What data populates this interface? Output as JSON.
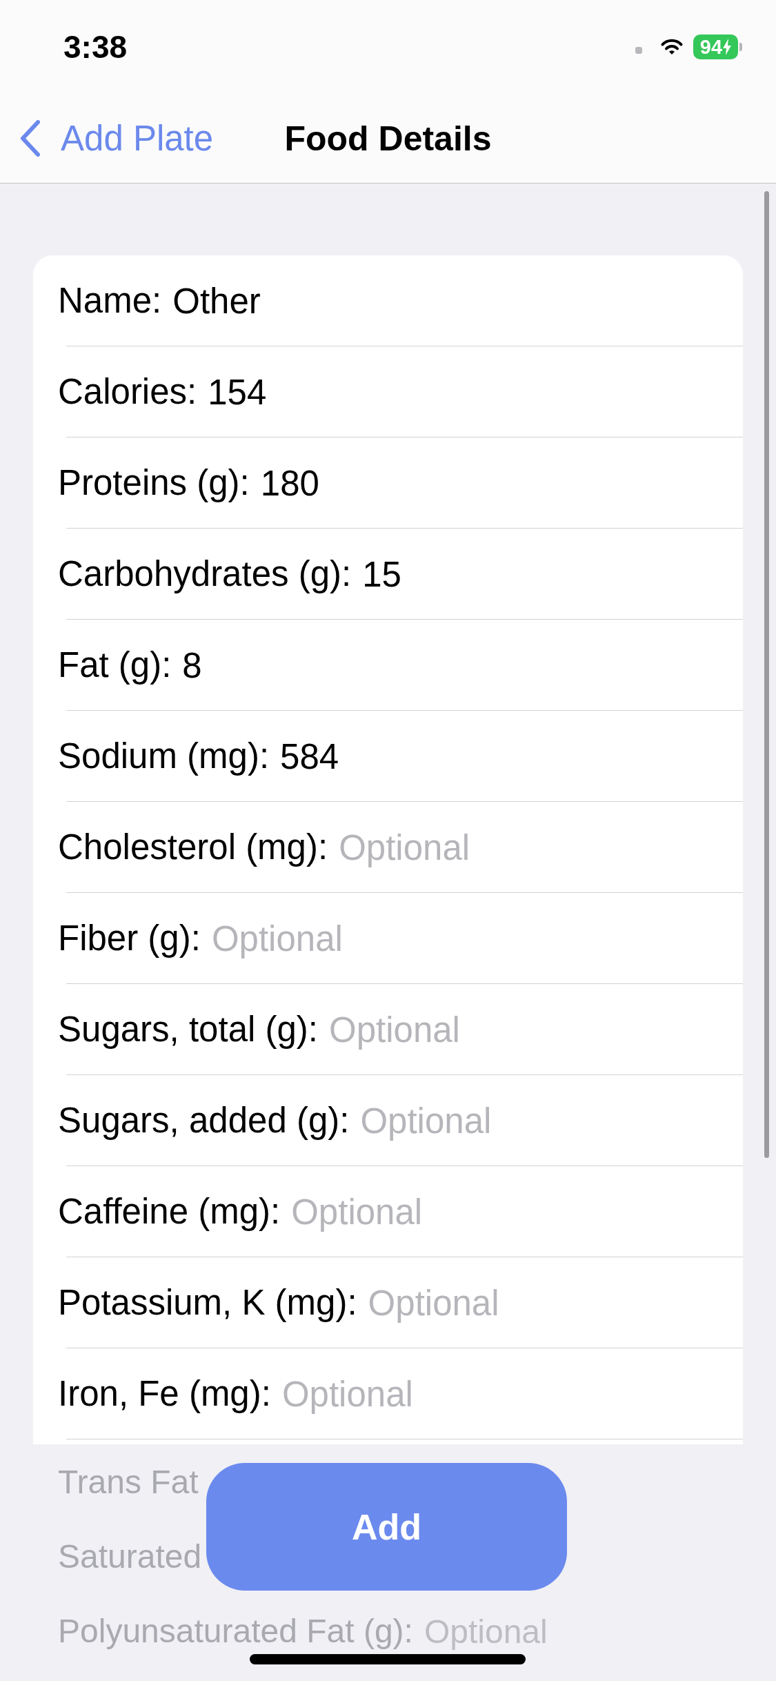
{
  "status_bar": {
    "time": "3:38",
    "battery": "94",
    "charging": true
  },
  "nav": {
    "back": "Add Plate",
    "title": "Food Details"
  },
  "rows": [
    {
      "label": "Name:",
      "value": "Other"
    },
    {
      "label": "Calories:",
      "value": "154"
    },
    {
      "label": "Proteins (g):",
      "value": "180"
    },
    {
      "label": "Carbohydrates (g):",
      "value": "15"
    },
    {
      "label": "Fat (g):",
      "value": "8"
    },
    {
      "label": "Sodium (mg):",
      "value": "584"
    },
    {
      "label": "Cholesterol (mg):",
      "placeholder": "Optional"
    },
    {
      "label": "Fiber (g):",
      "placeholder": "Optional"
    },
    {
      "label": "Sugars, total (g):",
      "placeholder": "Optional"
    },
    {
      "label": "Sugars, added (g):",
      "placeholder": "Optional"
    },
    {
      "label": "Caffeine (mg):",
      "placeholder": "Optional"
    },
    {
      "label": "Potassium, K (mg):",
      "placeholder": "Optional"
    },
    {
      "label": "Iron, Fe (mg):",
      "placeholder": "Optional"
    }
  ],
  "faded_rows": [
    {
      "label": "Trans Fat"
    },
    {
      "label": "Saturated"
    },
    {
      "label": "Polyunsaturated Fat (g):",
      "placeholder": "Optional"
    }
  ],
  "button": "Add"
}
